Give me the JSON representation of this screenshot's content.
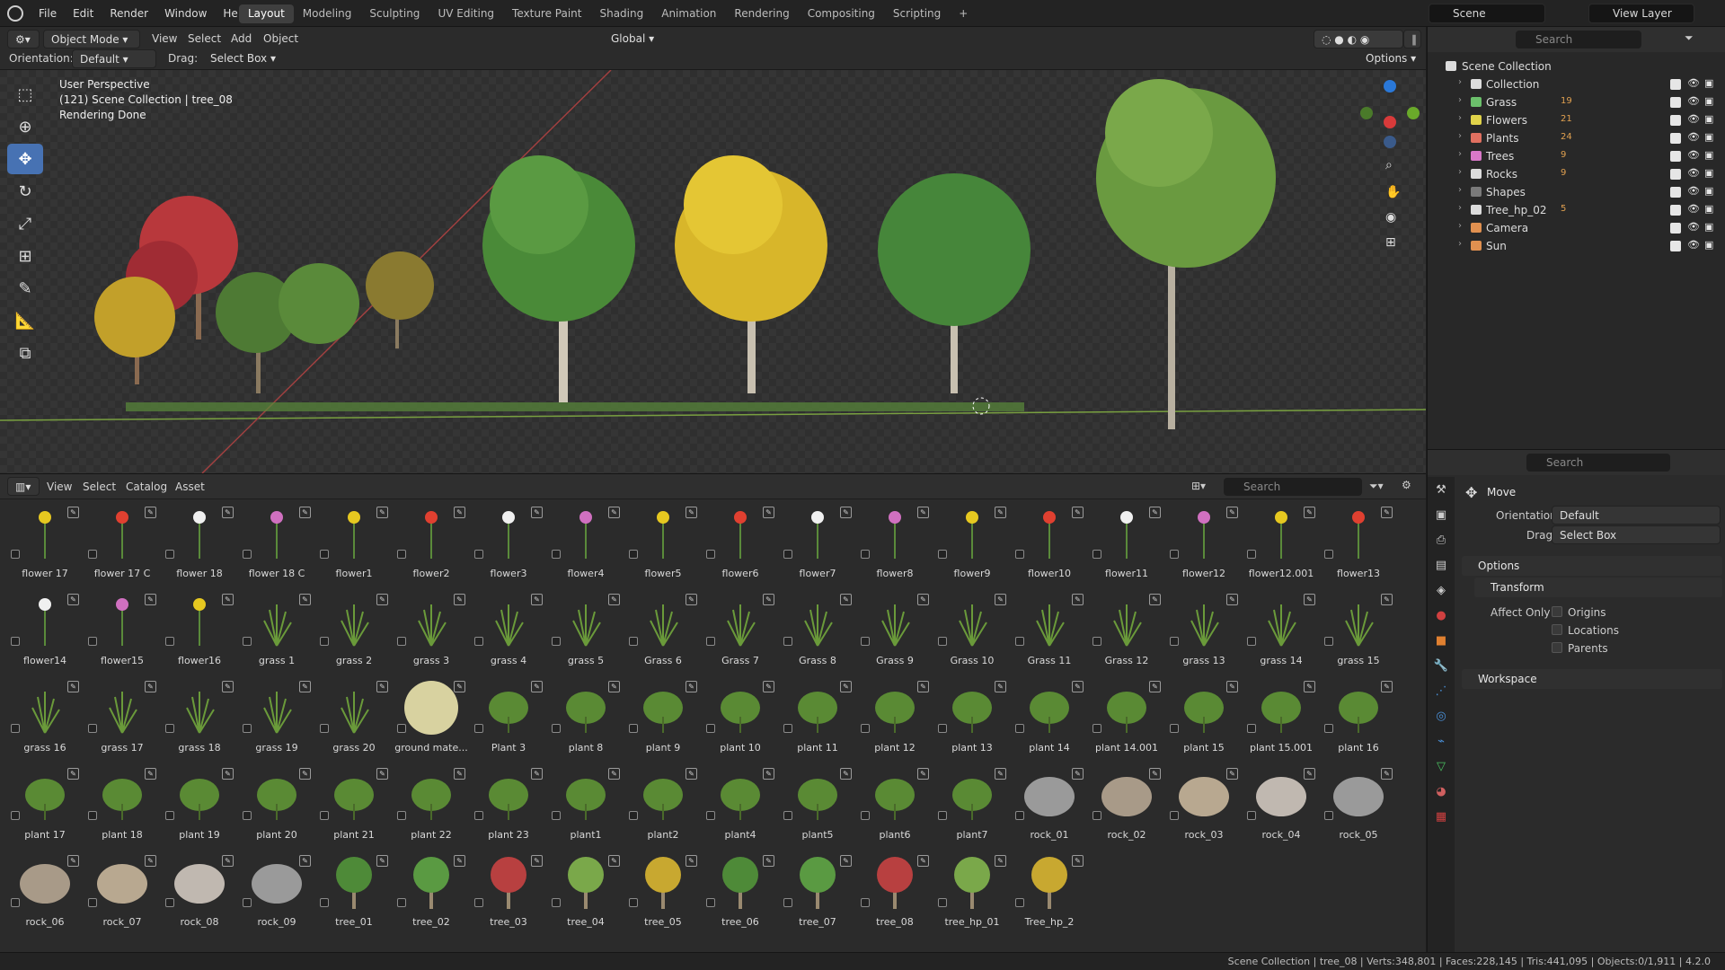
{
  "menu": [
    "File",
    "Edit",
    "Render",
    "Window",
    "Help"
  ],
  "workspaces": [
    "Layout",
    "Modeling",
    "Sculpting",
    "UV Editing",
    "Texture Paint",
    "Shading",
    "Animation",
    "Rendering",
    "Compositing",
    "Scripting"
  ],
  "add_workspace": "+",
  "scene_name": "Scene",
  "view_layer": "View Layer",
  "viewport": {
    "mode": "Object Mode",
    "menus": [
      "View",
      "Select",
      "Add",
      "Object"
    ],
    "orientation_global": "Global",
    "orientation_label": "Orientation:",
    "orientation_value": "Default",
    "drag_label": "Drag:",
    "drag_value": "Select Box",
    "options": "Options",
    "info_line1": "User Perspective",
    "info_line2": "(121) Scene Collection | tree_08",
    "info_line3": "Rendering Done"
  },
  "outliner": {
    "search_placeholder": "Search",
    "root": "Scene Collection",
    "items": [
      {
        "name": "Collection",
        "badge": "",
        "color": "#dcdcdc"
      },
      {
        "name": "Grass",
        "badge": "19",
        "color": "#6bc06b"
      },
      {
        "name": "Flowers",
        "badge": "21",
        "color": "#e0d34a"
      },
      {
        "name": "Plants",
        "badge": "24",
        "color": "#e07060"
      },
      {
        "name": "Trees",
        "badge": "9",
        "color": "#d878c8"
      },
      {
        "name": "Rocks",
        "badge": "9",
        "color": "#dcdcdc"
      },
      {
        "name": "Shapes",
        "badge": "",
        "color": "#7a7a7a"
      },
      {
        "name": "Tree_hp_02",
        "badge": "5",
        "color": "#dcdcdc"
      },
      {
        "name": "Camera",
        "badge": "",
        "color": "#e09050"
      },
      {
        "name": "Sun",
        "badge": "",
        "color": "#e09050"
      }
    ]
  },
  "properties": {
    "search_placeholder": "Search",
    "tool_name": "Move",
    "orientation_label": "Orientation",
    "orientation_value": "Default",
    "drag_label": "Drag:",
    "drag_value": "Select Box",
    "options_panel": "Options",
    "transform_panel": "Transform",
    "affect_only": "Affect Only",
    "checks": [
      "Origins",
      "Locations",
      "Parents"
    ],
    "workspace_panel": "Workspace"
  },
  "asset_browser": {
    "menus": [
      "View",
      "Select",
      "Catalog",
      "Asset"
    ],
    "search_placeholder": "Search",
    "assets": [
      "flower 17",
      "flower 17 C",
      "flower 18",
      "flower 18 C",
      "flower1",
      "flower2",
      "flower3",
      "flower4",
      "flower5",
      "flower6",
      "flower7",
      "flower8",
      "flower9",
      "flower10",
      "flower11",
      "flower12",
      "flower12.001",
      "flower13",
      "flower14",
      "flower15",
      "flower16",
      "grass 1",
      "grass 2",
      "grass 3",
      "grass 4",
      "grass 5",
      "Grass 6",
      "Grass 7",
      "Grass 8",
      "Grass 9",
      "Grass 10",
      "Grass 11",
      "Grass 12",
      "grass 13",
      "grass 14",
      "grass 15",
      "grass 16",
      "grass 17",
      "grass 18",
      "grass 19",
      "grass 20",
      "ground mate...",
      "Plant 3",
      "plant 8",
      "plant 9",
      "plant 10",
      "plant 11",
      "plant 12",
      "plant 13",
      "plant 14",
      "plant 14.001",
      "plant 15",
      "plant 15.001",
      "plant 16",
      "plant 17",
      "plant 18",
      "plant 19",
      "plant 20",
      "plant 21",
      "plant 22",
      "plant 23",
      "plant1",
      "plant2",
      "plant4",
      "plant5",
      "plant6",
      "plant7",
      "rock_01",
      "rock_02",
      "rock_03",
      "rock_04",
      "rock_05",
      "rock_06",
      "rock_07",
      "rock_08",
      "rock_09",
      "tree_01",
      "tree_02",
      "tree_03",
      "tree_04",
      "tree_05",
      "tree_06",
      "tree_07",
      "tree_08",
      "tree_hp_01",
      "Tree_hp_2"
    ]
  },
  "status_bar": "Scene Collection | tree_08 | Verts:348,801 | Faces:228,145 | Tris:441,095 | Objects:0/1,911 | 4.2.0"
}
